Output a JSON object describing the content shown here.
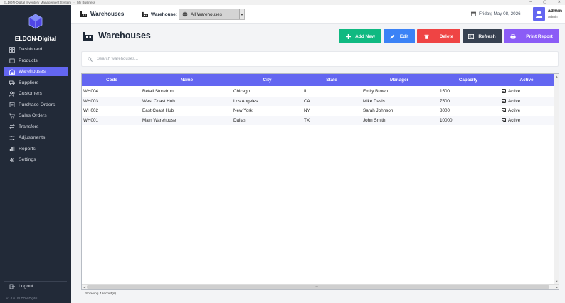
{
  "titlebar": {
    "app_name": "ELDON-Digital Inventory Management System",
    "separator": "-",
    "business": "My Business",
    "minimize": "–",
    "maximize": "▢",
    "close": "✕"
  },
  "sidebar": {
    "brand": "ELDON-Digital",
    "items": [
      {
        "label": "Dashboard",
        "icon": "dashboard-icon"
      },
      {
        "label": "Products",
        "icon": "box-icon"
      },
      {
        "label": "Warehouses",
        "icon": "warehouse-icon",
        "active": true
      },
      {
        "label": "Suppliers",
        "icon": "truck-icon"
      },
      {
        "label": "Customers",
        "icon": "users-icon"
      },
      {
        "label": "Purchase Orders",
        "icon": "clipboard-icon"
      },
      {
        "label": "Sales Orders",
        "icon": "cart-icon"
      },
      {
        "label": "Transfers",
        "icon": "transfer-icon"
      },
      {
        "label": "Adjustments",
        "icon": "sliders-icon"
      },
      {
        "label": "Reports",
        "icon": "chart-icon"
      },
      {
        "label": "Settings",
        "icon": "gear-icon"
      }
    ],
    "logout": "Logout",
    "version": "v1.0.0 | ELDON-Digital"
  },
  "topbar": {
    "title": "Warehouses",
    "warehouse_label": "Warehouse:",
    "warehouse_selected": "All Warehouses",
    "date": "Friday, May 08, 2026",
    "user_name": "admin",
    "user_role": "Admin"
  },
  "page": {
    "title": "Warehouses",
    "buttons": {
      "add": "Add New",
      "edit": "Edit",
      "delete": "Delete",
      "refresh": "Refresh",
      "print": "Print Report"
    },
    "search_placeholder": "Search warehouses..."
  },
  "table": {
    "columns": [
      "Code",
      "Name",
      "City",
      "State",
      "Manager",
      "Capacity",
      "Active"
    ],
    "rows": [
      [
        "WH004",
        "Retail Storefront",
        "Chicago",
        "IL",
        "Emily Brown",
        "1500",
        "Active"
      ],
      [
        "WH003",
        "West Coast Hub",
        "Los Angeles",
        "CA",
        "Mike Davis",
        "7500",
        "Active"
      ],
      [
        "WH002",
        "East Coast Hub",
        "New York",
        "NY",
        "Sarah Johnson",
        "8000",
        "Active"
      ],
      [
        "WH001",
        "Main Warehouse",
        "Dallas",
        "TX",
        "John Smith",
        "10000",
        "Active"
      ]
    ]
  },
  "status": "Showing 4 record(s)",
  "colors": {
    "sidebar": "#222a38",
    "accent": "#6366f1",
    "add": "#10b981",
    "edit": "#3b82f6",
    "delete": "#ef4444",
    "refresh": "#374151",
    "print": "#8b5cf6"
  }
}
